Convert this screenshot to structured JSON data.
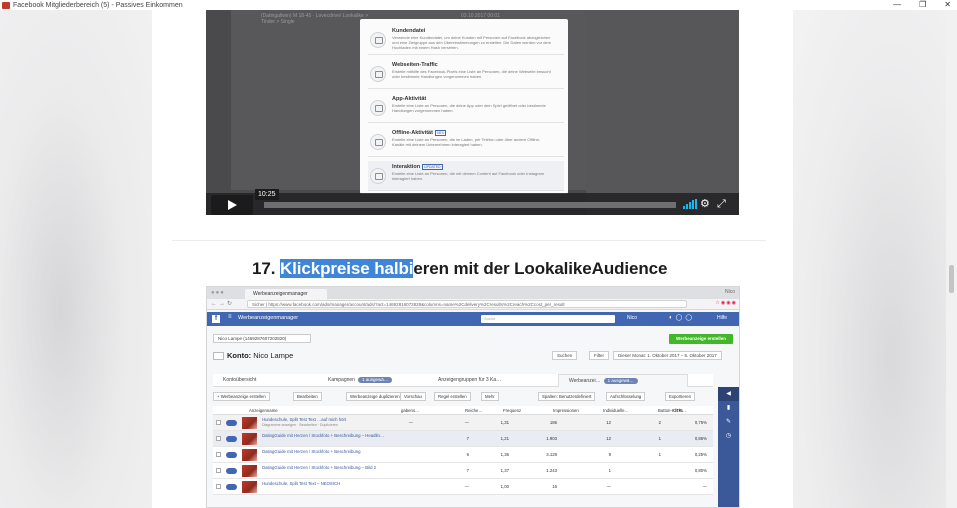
{
  "window": {
    "title": "Facebook Mitgliederbereich (5) - Passives Einkommen",
    "controls": {
      "minimize": "—",
      "restore": "❐",
      "close": "✕"
    }
  },
  "video": {
    "time": "10:25",
    "progress": 0.0,
    "bg_row_text": "(Datingaltwin) M 18-45 · Lovecdrive/ Lookalike > Tinder > Single",
    "bg_row_date": "03.10.2017 00:01",
    "options": [
      {
        "title": "Kundendatei",
        "tag": "",
        "desc": "Verwende eine Kundendatei, um deine Kunden mit Personen auf Facebook abzugleichen und eine Zielgruppe aus den Übereinstimmungen zu erstellen. Die Daten werden vor dem Hochladen mit einem Hash versehen."
      },
      {
        "title": "Webseiten-Traffic",
        "tag": "",
        "desc": "Erstelle mithilfe des Facebook-Pixels eine Liste an Personen, die deine Webseite besucht oder bestimmte Handlungen vorgenommen haben."
      },
      {
        "title": "App-Aktivität",
        "tag": "",
        "desc": "Erstelle eine Liste an Personen, die deine App oder dein Spiel geöffnet oder bestimmte Handlungen vorgenommen haben."
      },
      {
        "title": "Offline-Aktivität",
        "tag": "NEU",
        "desc": "Erstelle eine Liste an Personen, die im Laden, per Telefon oder über andere Offline-Kanäle mit deinem Unternehmen interagiert haben."
      },
      {
        "title": "Interaktion",
        "tag": "UPDATED",
        "desc": "Erstelle eine Liste an Personen, die mit deinem Content auf Facebook oder Instagram interagiert haben."
      }
    ],
    "icons": {
      "volume": "volume-icon",
      "settings": "gear-icon",
      "fullscreen": "fullscreen-icon"
    }
  },
  "heading": {
    "prefix": "17. ",
    "highlighted": "Klickpreise halbi",
    "rest": "eren mit der LookalikeAudience"
  },
  "screenshot": {
    "browser": {
      "tab_title": "Werbeanzeigenmanager",
      "url": "Sicher | https://www.facebook.com/ads/manager/account/ads/?act=14692816072828&columns=name%2Cdelivery%2Cresults%2Creach%2Ccost_per_result",
      "user": "Nico"
    },
    "fb": {
      "app_name": "Werbeanzeigenmanager",
      "search_placeholder": "Suche",
      "user_name": "Nico",
      "help": "Hilfe"
    },
    "account_select": "Nico Lampe (1469287607202820)",
    "create_button": "Werbeanzeige erstellen",
    "konto_label": "Konto:",
    "konto_name": "Nico Lampe",
    "filters": {
      "search": "Suchen",
      "filter": "Filter",
      "date": "Dieser Monat: 1. Oktober 2017 – 5. Oktober 2017"
    },
    "levels": [
      {
        "label": "Kontoübersicht",
        "pill": ""
      },
      {
        "label": "Kampagnen",
        "pill": "1 ausgewä…"
      },
      {
        "label": "Anzeigengruppen für 3 Ka…",
        "pill": ""
      },
      {
        "label": "Werbeanzei…",
        "pill": "1 ausgewä…"
      }
    ],
    "toolbar": [
      "+ Werbeanzeige erstellen",
      "Bearbeiten",
      "Werbeanzeige duplizieren",
      "Vorschau",
      "Regel erstellen",
      "Mehr",
      "Spalten: Benutzerdefiniert",
      "Aufschlüsselung",
      "Exportieren"
    ],
    "columns": [
      "Anzeigenname",
      "gabens…",
      "Reiche…",
      "Frequenz",
      "Impressionen",
      "Individuelle…",
      "Button-Klicks",
      "CTR…"
    ],
    "rows": [
      {
        "name": "Hundeschule, Split Test Text …auf mich hört",
        "sub": "Diagramme anzeigen · Bearbeiten · Duplizieren",
        "vals": [
          "—",
          "—",
          "1,31",
          "186",
          "12",
          "2",
          "0,75%"
        ]
      },
      {
        "name": "DatingGuide mit Herzen / Stockfoto + Beschreibung – Headlin…",
        "sub": "",
        "vals": [
          "",
          "7",
          "1,21",
          "1.903",
          "12",
          "1",
          "0,86%"
        ]
      },
      {
        "name": "DatingGuide mit Herzen / Stockfoto + Beschreibung",
        "sub": "",
        "vals": [
          "",
          "6",
          "1,36",
          "3.129",
          "9",
          "1",
          "0,25%"
        ]
      },
      {
        "name": "DatingGuide mit Herzen / Stockfoto + Beschreibung – Bild 2",
        "sub": "",
        "vals": [
          "",
          "7",
          "1,37",
          "1.243",
          "1",
          "",
          "0,80%"
        ]
      },
      {
        "name": "Hundeschule, Split Test Text – NEOSICH",
        "sub": "",
        "vals": [
          "",
          "—",
          "1,00",
          "16",
          "—",
          "",
          "—"
        ]
      }
    ]
  },
  "colors": {
    "fb_blue": "#4267b2",
    "highlight": "#3f86d8",
    "green": "#42b72a",
    "player_blue": "#19b7ea"
  }
}
